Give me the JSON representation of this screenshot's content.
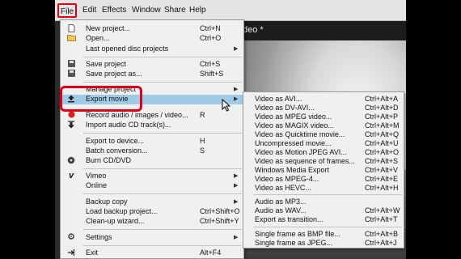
{
  "menubar": {
    "items": [
      {
        "label": "File"
      },
      {
        "label": "Edit"
      },
      {
        "label": "Effects"
      },
      {
        "label": "Window"
      },
      {
        "label": "Share"
      },
      {
        "label": "Help"
      }
    ]
  },
  "window_title": "deo *",
  "file_menu": {
    "items": [
      {
        "label": "New project...",
        "shortcut": "Ctrl+N",
        "icon": "new-file-icon"
      },
      {
        "label": "Open...",
        "shortcut": "Ctrl+O",
        "icon": "open-folder-icon"
      },
      {
        "label": "Last opened disc projects",
        "shortcut": "",
        "icon": ""
      },
      {
        "label": "Save project",
        "shortcut": "Ctrl+S",
        "icon": "save-icon"
      },
      {
        "label": "Save project as...",
        "shortcut": "Shift+S",
        "icon": "save-as-icon"
      },
      {
        "label": "Manage project",
        "shortcut": "",
        "icon": ""
      },
      {
        "label": "Export movie",
        "shortcut": "",
        "icon": "export-icon"
      },
      {
        "label": "Record audio / images / video...",
        "shortcut": "R",
        "icon": "record-icon"
      },
      {
        "label": "Import audio CD track(s)...",
        "shortcut": "",
        "icon": "import-cd-icon"
      },
      {
        "label": "Export to device...",
        "shortcut": "H",
        "icon": ""
      },
      {
        "label": "Batch conversion...",
        "shortcut": "S",
        "icon": ""
      },
      {
        "label": "Burn CD/DVD",
        "shortcut": "",
        "icon": "disc-icon"
      },
      {
        "label": "Vimeo",
        "shortcut": "",
        "icon": "vimeo-icon"
      },
      {
        "label": "Online",
        "shortcut": "",
        "icon": ""
      },
      {
        "label": "Backup copy",
        "shortcut": "",
        "icon": ""
      },
      {
        "label": "Load backup project...",
        "shortcut": "Ctrl+Shift+O",
        "icon": ""
      },
      {
        "label": "Clean-up wizard...",
        "shortcut": "Ctrl+Shift+Y",
        "icon": ""
      },
      {
        "label": "Settings",
        "shortcut": "",
        "icon": "gear-icon"
      },
      {
        "label": "Exit",
        "shortcut": "Alt+F4",
        "icon": "exit-icon"
      }
    ]
  },
  "export_submenu": {
    "items": [
      {
        "label": "Video as AVI...",
        "shortcut": "Ctrl+Alt+A"
      },
      {
        "label": "Video as DV-AVI...",
        "shortcut": "Ctrl+Alt+D"
      },
      {
        "label": "Video as MPEG video...",
        "shortcut": "Ctrl+Alt+P"
      },
      {
        "label": "Video as MAGIX video...",
        "shortcut": "Ctrl+Alt+M"
      },
      {
        "label": "Video as Quicktime movie...",
        "shortcut": "Ctrl+Alt+Q"
      },
      {
        "label": "Uncompressed movie...",
        "shortcut": "Ctrl+Alt+U"
      },
      {
        "label": "Video as Motion JPEG AVI...",
        "shortcut": "Ctrl+Alt+O"
      },
      {
        "label": "Video as sequence of frames...",
        "shortcut": "Ctrl+Alt+S"
      },
      {
        "label": "Windows Media Export",
        "shortcut": "Ctrl+Alt+V"
      },
      {
        "label": "Video as MPEG-4...",
        "shortcut": "Ctrl+Alt+E"
      },
      {
        "label": "Video as HEVC...",
        "shortcut": "Ctrl+Alt+H"
      },
      {
        "label": "Audio as MP3...",
        "shortcut": ""
      },
      {
        "label": "Audio as WAV...",
        "shortcut": "Ctrl+Alt+W"
      },
      {
        "label": "Export as transition...",
        "shortcut": "Ctrl+Alt+T"
      },
      {
        "label": "Single frame as BMP file...",
        "shortcut": "Ctrl+Alt+B"
      },
      {
        "label": "Single frame as JPEG...",
        "shortcut": "Ctrl+Alt+J"
      }
    ]
  },
  "colors": {
    "highlight": "#9fcbe6",
    "annotation": "#e0001a",
    "menu_bg": "#f0f0f0"
  }
}
